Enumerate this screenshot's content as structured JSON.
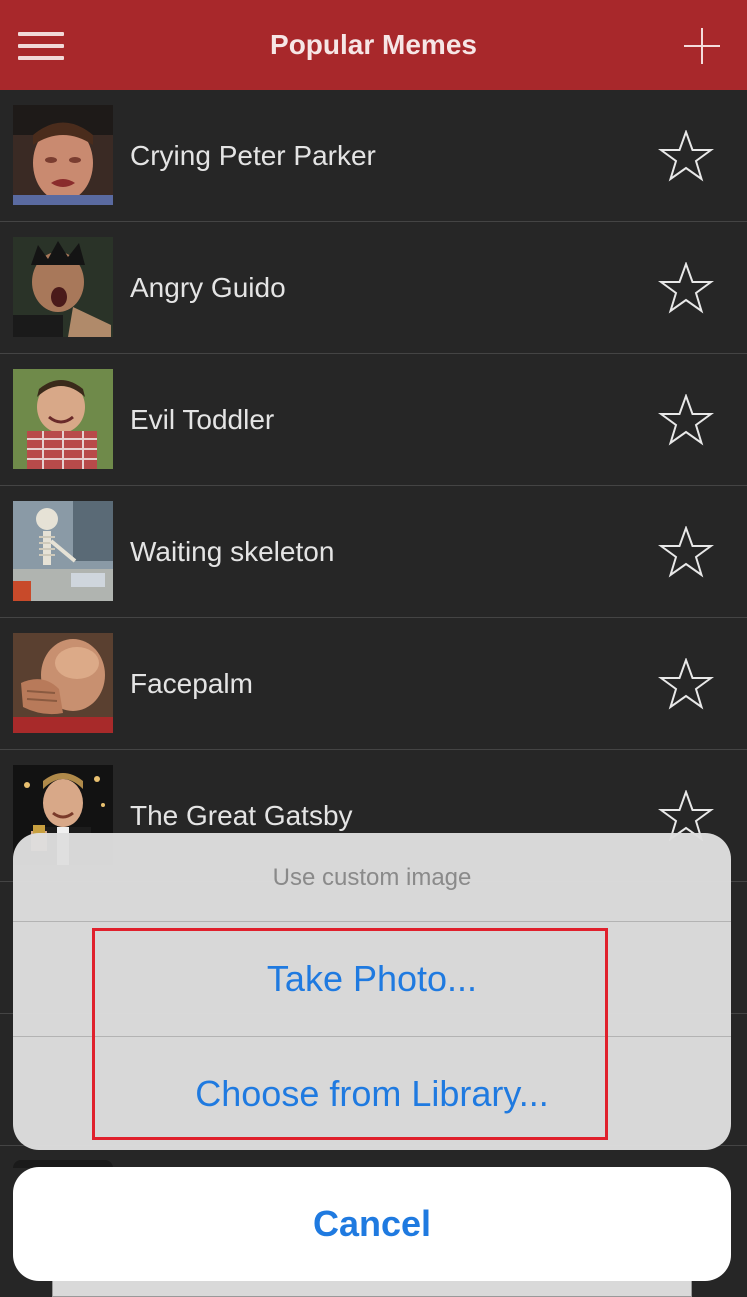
{
  "navbar": {
    "title": "Popular Memes",
    "menu_icon": "hamburger-menu-icon",
    "add_icon": "plus-icon",
    "color": "#a8282b"
  },
  "memes": [
    {
      "label": "Crying Peter Parker",
      "thumb": "crying-peter-parker-thumbnail"
    },
    {
      "label": "Angry Guido",
      "thumb": "angry-guido-thumbnail"
    },
    {
      "label": "Evil Toddler",
      "thumb": "evil-toddler-thumbnail"
    },
    {
      "label": "Waiting skeleton",
      "thumb": "waiting-skeleton-thumbnail"
    },
    {
      "label": "Facepalm",
      "thumb": "facepalm-thumbnail"
    },
    {
      "label": "The Great Gatsby",
      "thumb": "great-gatsby-thumbnail"
    }
  ],
  "action_sheet": {
    "title": "Use custom image",
    "take_photo": "Take Photo...",
    "choose_library": "Choose from Library...",
    "cancel": "Cancel",
    "button_color": "#1f7ae0",
    "highlight_color": "#e0202c"
  }
}
